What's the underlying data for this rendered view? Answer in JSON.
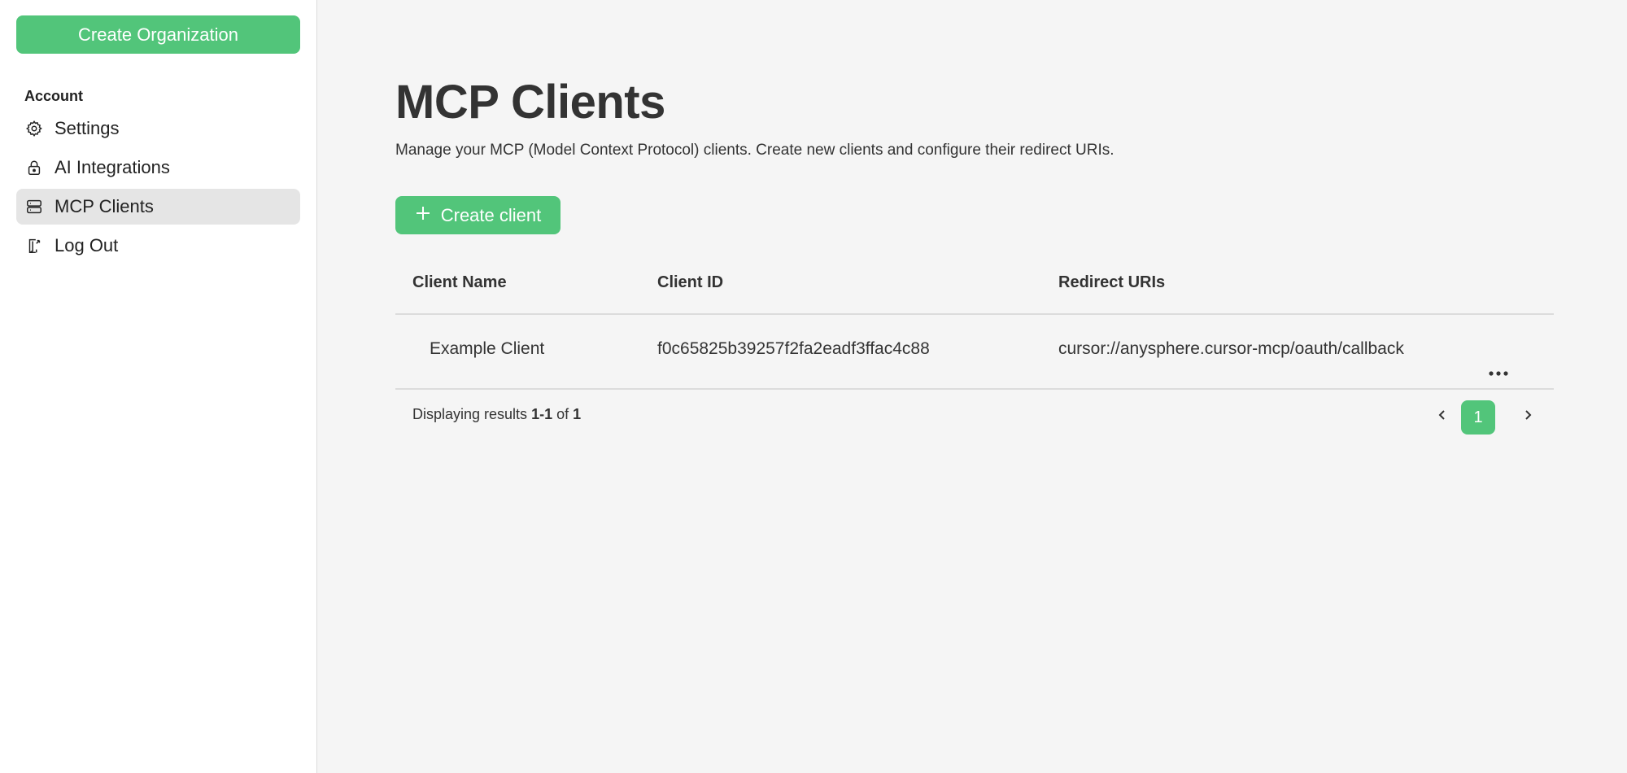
{
  "sidebar": {
    "create_org_label": "Create Organization",
    "section_label": "Account",
    "items": [
      {
        "label": "Settings",
        "icon": "gear-icon",
        "active": false
      },
      {
        "label": "AI Integrations",
        "icon": "lock-icon",
        "active": false
      },
      {
        "label": "MCP Clients",
        "icon": "server-icon",
        "active": true
      },
      {
        "label": "Log Out",
        "icon": "logout-icon",
        "active": false
      }
    ]
  },
  "main": {
    "title": "MCP Clients",
    "subtitle": "Manage your MCP (Model Context Protocol) clients. Create new clients and configure their redirect URIs.",
    "create_button_label": "Create client",
    "table": {
      "columns": [
        "Client Name",
        "Client ID",
        "Redirect URIs"
      ],
      "rows": [
        {
          "name": "Example Client",
          "id": "f0c65825b39257f2fa2eadf3ffac4c88",
          "redirect": "cursor://anysphere.cursor-mcp/oauth/callback"
        }
      ]
    },
    "pagination": {
      "prefix": "Displaying results",
      "range": "1-1",
      "of": "of",
      "total": "1",
      "current_page": "1"
    }
  },
  "colors": {
    "accent": "#52c57a",
    "sidebar_bg": "#ffffff",
    "main_bg": "#f5f5f5",
    "active_item_bg": "#e5e5e5"
  }
}
